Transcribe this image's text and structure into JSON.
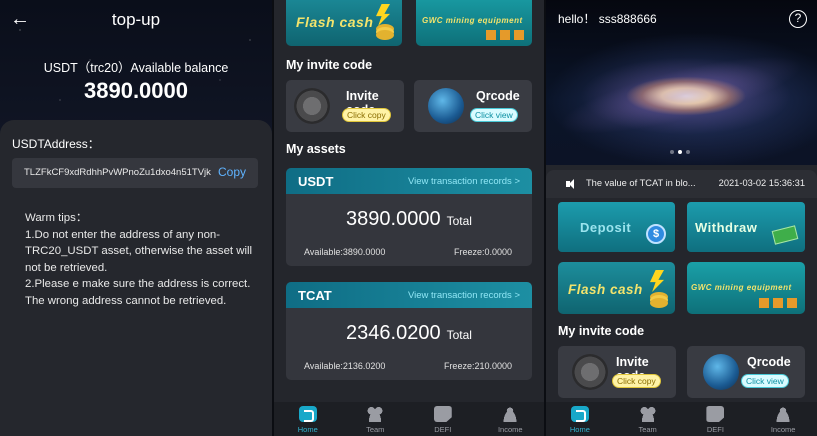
{
  "topup": {
    "title": "top-up",
    "balance_label": "USDT（trc20）Available balance",
    "balance_value": "3890.0000",
    "address_label": "USDTAddress：",
    "address_value": "TLZFkCF9xdRdhhPvWPnoZu1dxo4n51TVjk",
    "copy_label": "Copy",
    "tips_title": "Warm tips：",
    "tip1": "1.Do not enter the address of any non-TRC20_USDT asset, otherwise the asset will not be retrieved.",
    "tip2": "2.Please e make sure the address is correct. The wrong address cannot be retrieved."
  },
  "banners": {
    "flash_cash": "Flash cash",
    "gwc": "GWC mining equipment"
  },
  "invite": {
    "section_title": "My invite code",
    "invite_title": "Invite code",
    "invite_btn": "Click copy",
    "qr_title": "Qrcode",
    "qr_btn": "Click view"
  },
  "assets": {
    "section_title": "My assets",
    "usdt": {
      "name": "USDT",
      "link": "View transaction records >",
      "value": "3890.0000",
      "total_label": "Total",
      "available": "Available:3890.0000",
      "freeze": "Freeze:0.0000"
    },
    "tcat": {
      "name": "TCAT",
      "link": "View transaction records >",
      "value": "2346.0200",
      "total_label": "Total",
      "available": "Available:2136.0200",
      "freeze": "Freeze:210.0000"
    }
  },
  "nav": {
    "home": "Home",
    "team": "Team",
    "defi": "DEFI",
    "income": "Income"
  },
  "home": {
    "hello": "hello！ sss888666",
    "help": "?",
    "notice_text": "The value of TCAT in blo...",
    "notice_date": "2021-03-02 15:36:31",
    "deposit": "Deposit",
    "withdraw": "Withdraw",
    "coin_glyph": "$"
  },
  "colors": {
    "accent": "#18a8c9",
    "link": "#5fb3ff"
  }
}
